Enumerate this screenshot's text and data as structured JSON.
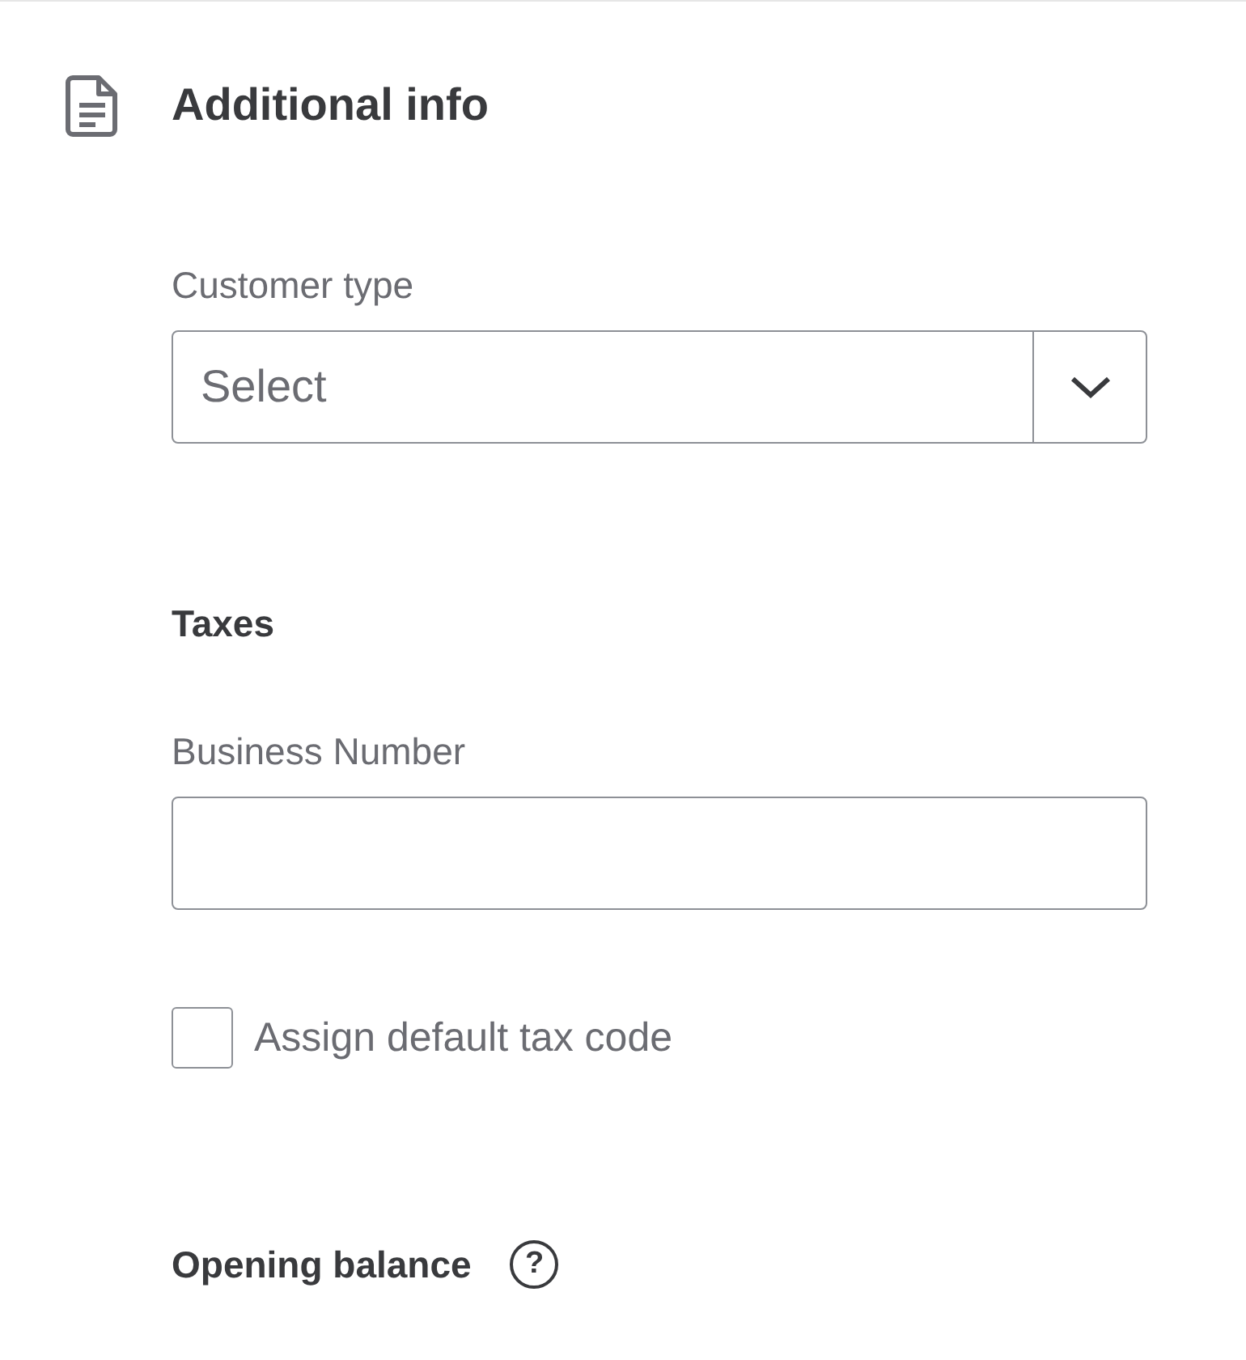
{
  "section": {
    "title": "Additional info"
  },
  "customer_type": {
    "label": "Customer type",
    "placeholder": "Select"
  },
  "taxes": {
    "heading": "Taxes",
    "business_number": {
      "label": "Business Number"
    },
    "default_tax_code": {
      "label": "Assign default tax code",
      "checked": false
    }
  },
  "opening_balance": {
    "heading": "Opening balance",
    "help": "?"
  }
}
